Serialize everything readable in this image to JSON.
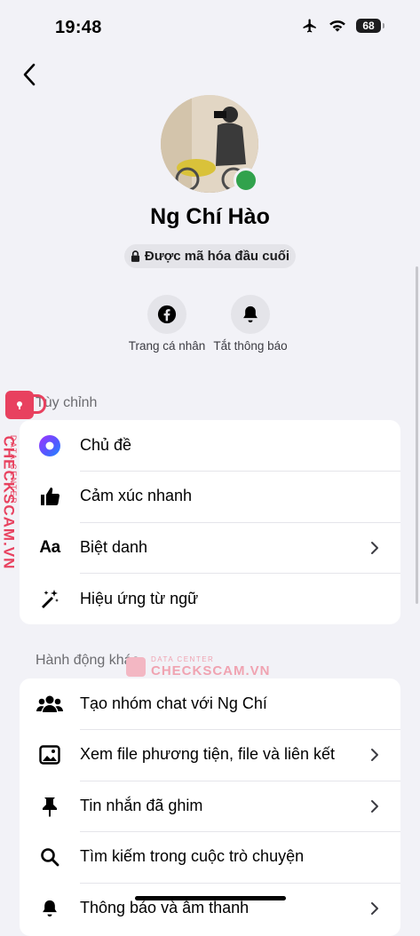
{
  "status_bar": {
    "time": "19:48",
    "battery": "68"
  },
  "profile": {
    "name": "Ng Chí Hào",
    "encryption_badge": "Được mã hóa đầu cuối"
  },
  "quick_actions": [
    {
      "label": "Trang cá nhân",
      "icon": "facebook-icon"
    },
    {
      "label": "Tắt thông báo",
      "icon": "bell-icon"
    }
  ],
  "customize": {
    "title": "Tùy chỉnh",
    "items": [
      {
        "label": "Chủ đề",
        "icon": "theme-icon",
        "chevron": false
      },
      {
        "label": "Cảm xúc nhanh",
        "icon": "thumbs-up-icon",
        "chevron": false
      },
      {
        "label": "Biệt danh",
        "icon": "aa-icon",
        "icon_text": "Aa",
        "chevron": true
      },
      {
        "label": "Hiệu ứng từ ngữ",
        "icon": "magic-wand-icon",
        "chevron": false
      }
    ]
  },
  "more_actions": {
    "title": "Hành động khác",
    "items": [
      {
        "label": "Tạo nhóm chat với Ng Chí",
        "icon": "group-icon",
        "chevron": false
      },
      {
        "label": "Xem file phương tiện, file và liên kết",
        "icon": "image-icon",
        "chevron": true
      },
      {
        "label": "Tin nhắn đã ghim",
        "icon": "pin-icon",
        "chevron": true
      },
      {
        "label": "Tìm kiếm trong cuộc trò chuyện",
        "icon": "search-icon",
        "chevron": false
      },
      {
        "label": "Thông báo và âm thanh",
        "icon": "bell-icon",
        "chevron": true
      }
    ]
  },
  "watermark": {
    "brand": "CHECKSCAM.VN",
    "tag": "DATA CENTER"
  },
  "colors": {
    "online": "#31a24c",
    "background": "#f2f2f7",
    "watermark": "#e8415f"
  }
}
